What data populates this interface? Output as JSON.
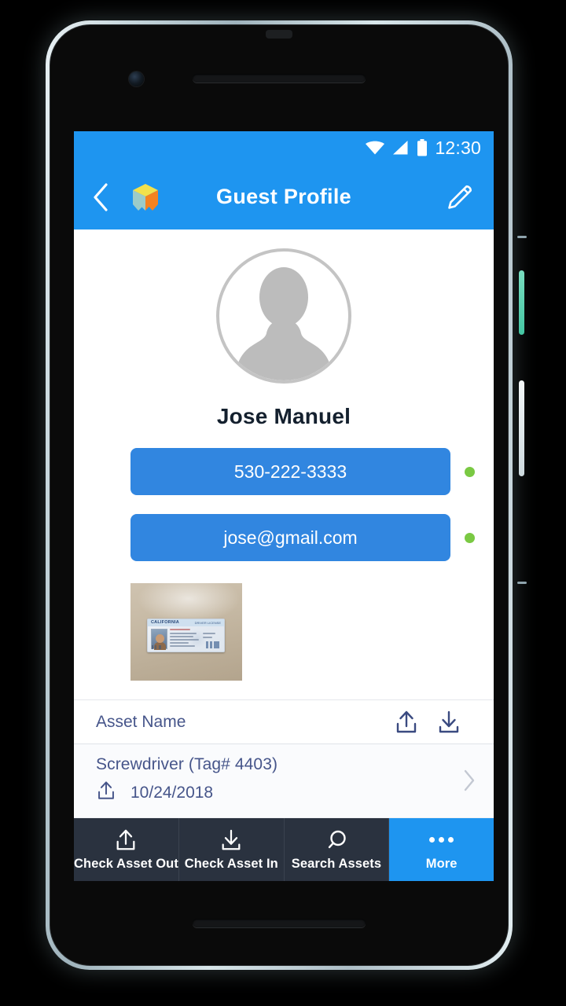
{
  "status_bar": {
    "time": "12:30",
    "icons": [
      "wifi-icon",
      "cell-signal-icon",
      "battery-icon"
    ]
  },
  "app_bar": {
    "back_icon": "chevron-left-icon",
    "logo_icon": "cube-logo-icon",
    "title": "Guest Profile",
    "edit_icon": "pencil-icon",
    "background_color": "#1E95F0"
  },
  "profile": {
    "avatar_icon": "person-placeholder-icon",
    "name": "Jose Manuel",
    "contacts": [
      {
        "value": "530-222-3333",
        "type": "phone",
        "status_color": "#7AC943"
      },
      {
        "value": "jose@gmail.com",
        "type": "email",
        "status_color": "#7AC943"
      }
    ],
    "id_photo": {
      "label": "CALIFORNIA",
      "sub_label": "DRIVER LICENSE",
      "alt": "photo of a California driver license on a tan surface"
    }
  },
  "asset_table": {
    "header_label": "Asset Name",
    "header_actions": [
      {
        "icon": "check-out-upload-icon"
      },
      {
        "icon": "check-in-download-icon"
      }
    ],
    "rows": [
      {
        "name": "Screwdriver (Tag# 4403)",
        "status_icon": "check-out-upload-icon",
        "date": "10/24/2018",
        "chevron": "chevron-right-icon"
      }
    ]
  },
  "bottom_nav": {
    "items": [
      {
        "label": "Check Asset Out",
        "icon": "upload-icon",
        "active": false
      },
      {
        "label": "Check Asset In",
        "icon": "download-icon",
        "active": false
      },
      {
        "label": "Search Assets",
        "icon": "search-icon",
        "active": false
      },
      {
        "label": "More",
        "icon": "more-dots-icon",
        "active": true
      }
    ],
    "background_color": "#2A323F",
    "active_color": "#1E95F0"
  }
}
